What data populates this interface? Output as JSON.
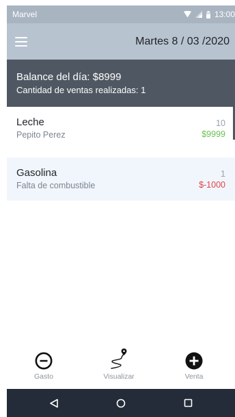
{
  "status_bar": {
    "carrier": "Marvel",
    "time": "13:00"
  },
  "app_bar": {
    "menu_icon": "hamburger-icon",
    "date": "Martes 8 / 03 /2020"
  },
  "summary": {
    "balance_text": "Balance del día: $8999",
    "sales_count_text": "Cantidad de ventas realizadas:  1"
  },
  "transactions": [
    {
      "title": "Leche",
      "subtitle": "Pepito Perez",
      "quantity": "10",
      "amount": "$9999",
      "type": "sale"
    },
    {
      "title": "Gasolina",
      "subtitle": "Falta de combustible",
      "quantity": "1",
      "amount": "$-1000",
      "type": "expense"
    }
  ],
  "bottom_nav": {
    "expense": {
      "label": "Gasto",
      "icon": "minus-circle-icon"
    },
    "visualize": {
      "label": "Visualizar",
      "icon": "route-pin-icon"
    },
    "sale": {
      "label": "Venta",
      "icon": "plus-circle-icon"
    }
  },
  "colors": {
    "positive": "#69c251",
    "negative": "#e2434b",
    "summary_bg": "#4f5862",
    "app_bar_bg": "#b8c3d0"
  }
}
